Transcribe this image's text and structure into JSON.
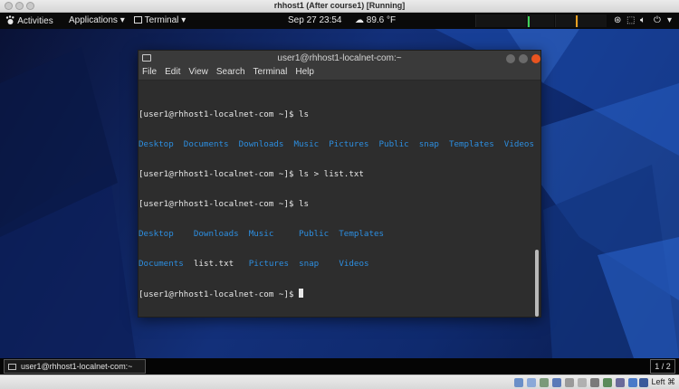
{
  "host_window": {
    "title": "rhhost1 (After course1) [Running]",
    "buttons": [
      "close",
      "minimize",
      "zoom"
    ]
  },
  "topbar": {
    "activities": "Activities",
    "applications": "Applications",
    "terminal_menu": "Terminal",
    "clock": "Sep 27  23:54",
    "weather": "89.6 °F"
  },
  "terminal": {
    "title": "user1@rhhost1-localnet-com:~",
    "menu": [
      "File",
      "Edit",
      "View",
      "Search",
      "Terminal",
      "Help"
    ],
    "lines": {
      "l1": "[user1@rhhost1-localnet-com ~]$ ls",
      "l2": "Desktop  Documents  Downloads  Music  Pictures  Public  snap  Templates  Videos",
      "l3": "[user1@rhhost1-localnet-com ~]$ ls > list.txt",
      "l4": "[user1@rhhost1-localnet-com ~]$ ls",
      "l5a": "Desktop    Downloads  Music     Public  Templates",
      "l6a": "Documents",
      "l6b": "list.txt",
      "l6c": "Pictures  snap    Videos",
      "l7": "[user1@rhhost1-localnet-com ~]$ "
    }
  },
  "taskbar": {
    "item": "user1@rhhost1-localnet-com:~",
    "workspace": "1 / 2"
  },
  "vbox_status": {
    "host_key": "Left ⌘"
  },
  "colors": {
    "dir_blue": "#2d8ee0",
    "terminal_bg": "#2d2d2d",
    "close_orange": "#e95420"
  }
}
